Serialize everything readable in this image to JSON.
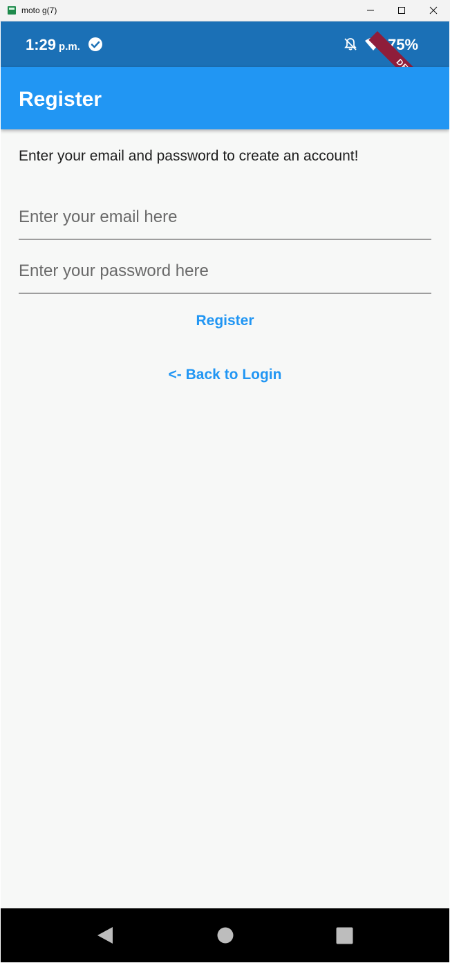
{
  "window": {
    "title": "moto g(7)",
    "app_icon": "android-studio-icon",
    "controls": [
      "minimize-icon",
      "maximize-icon",
      "close-icon"
    ]
  },
  "status_bar": {
    "time": "1:29",
    "ampm": "p.m.",
    "battery": "75%",
    "icons": [
      "check-circle-icon",
      "bell-off-icon",
      "wifi-icon"
    ],
    "color": "#1b70b6"
  },
  "debug_banner": "DEBUG",
  "app_bar": {
    "title": "Register",
    "color": "#2196f3"
  },
  "form": {
    "intro": "Enter your email and password to create an account!",
    "email": {
      "value": "",
      "placeholder": "Enter your email here"
    },
    "password": {
      "value": "",
      "placeholder": "Enter your password here"
    },
    "register_label": "Register",
    "back_label": "<- Back to Login"
  },
  "nav_bar": {
    "icons": [
      "back-triangle-icon",
      "home-circle-icon",
      "recents-square-icon"
    ]
  }
}
